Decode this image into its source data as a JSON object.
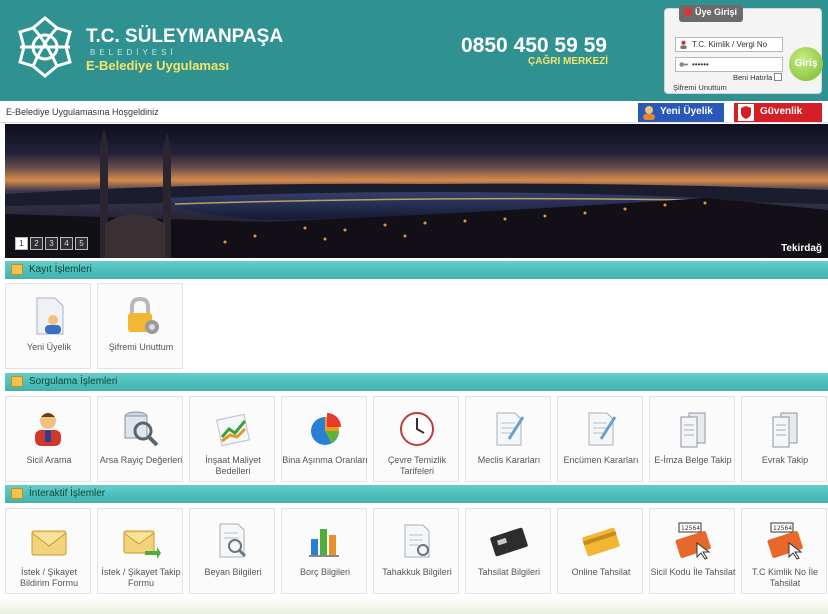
{
  "header": {
    "brand_title": "T.C. SÜLEYMANPAŞA",
    "brand_subtitle": "BELEDİYESİ",
    "brand_app": "E-Belediye Uygulaması",
    "phone": "0850 450 59 59",
    "callcenter": "ÇAĞRI MERKEZİ",
    "bg_color": "#2f9290",
    "accent_color": "#f3e56b"
  },
  "login": {
    "tab_label": "Üye Girişi",
    "id_placeholder": "T.C. Kimlik / Vergi No",
    "password_value": "••••••",
    "remember_label": "Beni Hatırla",
    "forgot_label": "Şifremi Unuttum",
    "submit_label": "Giriş"
  },
  "welcome_bar": {
    "text": "E-Belediye Uygulamasına Hoşgeldiniz",
    "new_user_label": "Yeni Üyelik",
    "security_label": "Güvenlik"
  },
  "banner": {
    "caption": "Tekirdağ",
    "slides": [
      "1",
      "2",
      "3",
      "4",
      "5"
    ]
  },
  "sections": {
    "kayit": {
      "title": "Kayıt İşlemleri",
      "items": [
        {
          "label": "Yeni Üyelik",
          "icon": "new-user-icon"
        },
        {
          "label": "Şifremi Unuttum",
          "icon": "lock-icon"
        }
      ]
    },
    "sorgu": {
      "title": "Sorgulama İşlemleri",
      "items": [
        {
          "label": "Sicil Arama",
          "icon": "person-search-icon"
        },
        {
          "label": "Arsa Rayiç Değerleri",
          "icon": "database-search-icon"
        },
        {
          "label": "İnşaat Maliyet Bedelleri",
          "icon": "line-chart-icon"
        },
        {
          "label": "Bina Aşınma Oranları",
          "icon": "pie-chart-icon"
        },
        {
          "label": "Çevre Temizlik Tarifeleri",
          "icon": "clock-icon"
        },
        {
          "label": "Meclis Kararları",
          "icon": "document-edit-icon"
        },
        {
          "label": "Encümen Kararları",
          "icon": "document-edit-icon"
        },
        {
          "label": "E-İmza Belge Takip",
          "icon": "document-stack-icon"
        },
        {
          "label": "Evrak Takip",
          "icon": "document-stack-icon"
        }
      ]
    },
    "inter": {
      "title": "İnteraktif İşlemler",
      "items": [
        {
          "label": "İstek / Şikayet Bildirim Formu",
          "icon": "envelope-icon"
        },
        {
          "label": "İstek / Şikayet Takip Formu",
          "icon": "envelope-arrow-icon"
        },
        {
          "label": "Beyan Bilgileri",
          "icon": "document-search-icon"
        },
        {
          "label": "Borç Bilgileri",
          "icon": "bar-chart-icon"
        },
        {
          "label": "Tahakkuk Bilgileri",
          "icon": "document-edit-icon"
        },
        {
          "label": "Tahsilat Bilgileri",
          "icon": "visa-card-icon"
        },
        {
          "label": "Online Tahsilat",
          "icon": "credit-card-icon"
        },
        {
          "label": "Sicil Kodu İle Tahsilat",
          "icon": "card-cursor-icon",
          "card_number": "12564"
        },
        {
          "label": "T.C Kimlik No İle Tahsilat",
          "icon": "card-cursor-icon",
          "card_number": "12564"
        }
      ]
    }
  }
}
